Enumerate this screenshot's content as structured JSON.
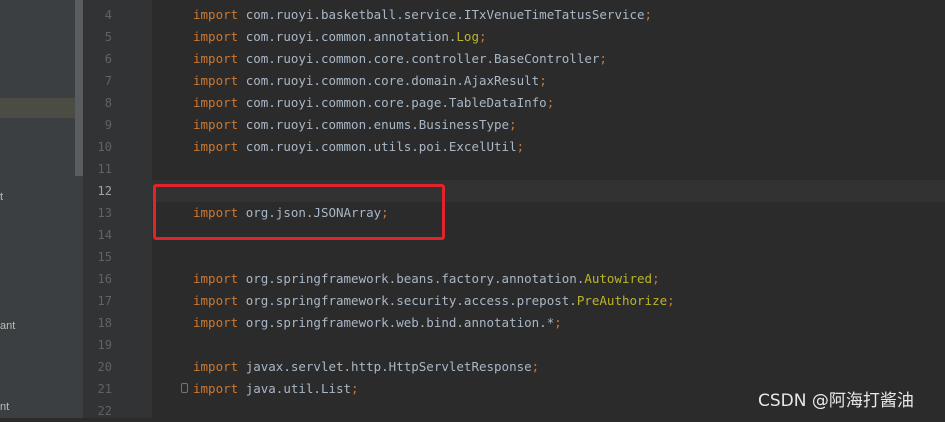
{
  "sidebar": {
    "items": [
      {
        "label": "t"
      },
      {
        "label": "ant"
      },
      {
        "label": "nt"
      }
    ]
  },
  "editor": {
    "current_line": "12",
    "lines": [
      {
        "num": "4",
        "kw": "import",
        "pkg": "com.ruoyi.basketball.service.ITxVenueTimeTatusService",
        "ann": "",
        "semi": ";"
      },
      {
        "num": "5",
        "kw": "import",
        "pkg": "com.ruoyi.common.annotation.",
        "ann": "Log",
        "semi": ";"
      },
      {
        "num": "6",
        "kw": "import",
        "pkg": "com.ruoyi.common.core.controller.BaseController",
        "ann": "",
        "semi": ";"
      },
      {
        "num": "7",
        "kw": "import",
        "pkg": "com.ruoyi.common.core.domain.AjaxResult",
        "ann": "",
        "semi": ";"
      },
      {
        "num": "8",
        "kw": "import",
        "pkg": "com.ruoyi.common.core.page.TableDataInfo",
        "ann": "",
        "semi": ";"
      },
      {
        "num": "9",
        "kw": "import",
        "pkg": "com.ruoyi.common.enums.BusinessType",
        "ann": "",
        "semi": ";"
      },
      {
        "num": "10",
        "kw": "import",
        "pkg": "com.ruoyi.common.utils.poi.ExcelUtil",
        "ann": "",
        "semi": ";"
      },
      {
        "num": "11",
        "kw": "",
        "pkg": "",
        "ann": "",
        "semi": ""
      },
      {
        "num": "12",
        "kw": "",
        "pkg": "",
        "ann": "",
        "semi": ""
      },
      {
        "num": "13",
        "kw": "import",
        "pkg": "org.json.JSONArray",
        "ann": "",
        "semi": ";"
      },
      {
        "num": "14",
        "kw": "",
        "pkg": "",
        "ann": "",
        "semi": ""
      },
      {
        "num": "15",
        "kw": "",
        "pkg": "",
        "ann": "",
        "semi": ""
      },
      {
        "num": "16",
        "kw": "import",
        "pkg": "org.springframework.beans.factory.annotation.",
        "ann": "Autowired",
        "semi": ";"
      },
      {
        "num": "17",
        "kw": "import",
        "pkg": "org.springframework.security.access.prepost.",
        "ann": "PreAuthorize",
        "semi": ";"
      },
      {
        "num": "18",
        "kw": "import",
        "pkg": "org.springframework.web.bind.annotation.*",
        "ann": "",
        "semi": ";"
      },
      {
        "num": "19",
        "kw": "",
        "pkg": "",
        "ann": "",
        "semi": ""
      },
      {
        "num": "20",
        "kw": "import",
        "pkg": "javax.servlet.http.HttpServletResponse",
        "ann": "",
        "semi": ";"
      },
      {
        "num": "21",
        "kw": "import",
        "pkg": "java.util.List",
        "ann": "",
        "semi": ";"
      },
      {
        "num": "22",
        "kw": "",
        "pkg": "",
        "ann": "",
        "semi": ""
      }
    ]
  },
  "watermark": "CSDN @阿海打酱油",
  "colors": {
    "keyword": "#cc7832",
    "annotation": "#bbb529",
    "text": "#a9b7c6",
    "background": "#2b2b2b",
    "highlight_box": "#e0242a"
  }
}
